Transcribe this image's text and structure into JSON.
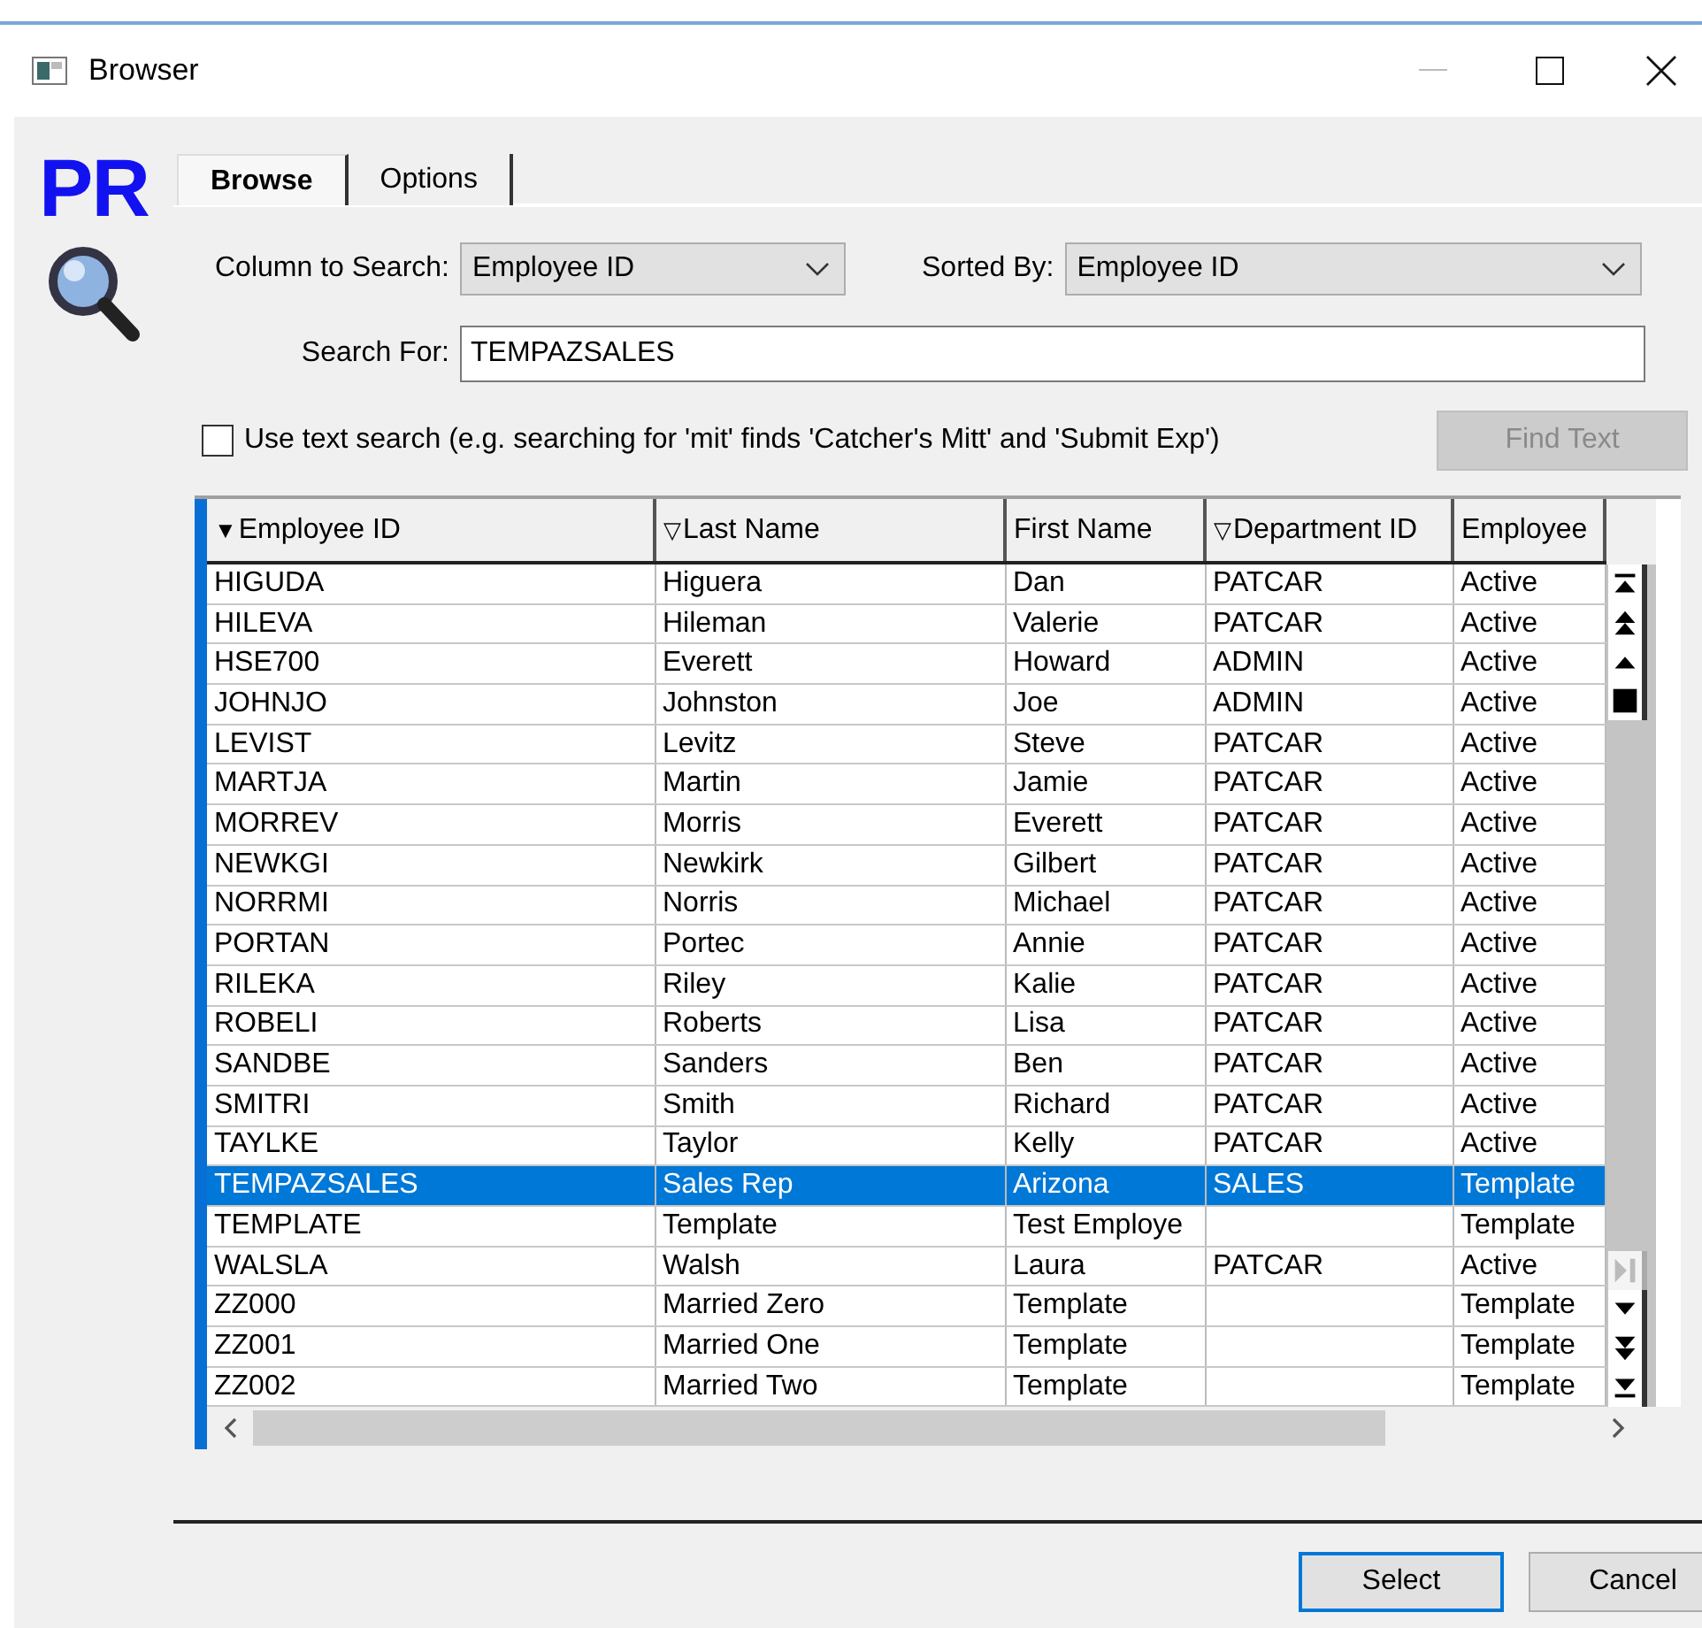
{
  "window": {
    "title": "Browser"
  },
  "logo": {
    "text": "PR"
  },
  "tabs": [
    {
      "label": "Browse",
      "selected": true
    },
    {
      "label": "Options",
      "selected": false
    }
  ],
  "column_to_search": {
    "label": "Column to Search:",
    "value": "Employee ID"
  },
  "sorted_by": {
    "label": "Sorted By:",
    "value": "Employee ID"
  },
  "search_for": {
    "label": "Search For:",
    "value": "TEMPAZSALES"
  },
  "text_search": {
    "label": "Use text search (e.g. searching for 'mit' finds 'Catcher's Mitt' and 'Submit Exp')",
    "checked": false
  },
  "find_text_button": {
    "label": "Find Text",
    "disabled": true
  },
  "table": {
    "columns": [
      {
        "label": "Employee ID",
        "sort_icon": "▼"
      },
      {
        "label": "Last Name",
        "sort_icon": "▽"
      },
      {
        "label": "First Name"
      },
      {
        "label": "Department ID",
        "sort_icon": "▽"
      },
      {
        "label": "Employee"
      }
    ],
    "rows": [
      {
        "cells": [
          "HIGUDA",
          "Higuera",
          "Dan",
          "PATCAR",
          "Active"
        ],
        "selected": false
      },
      {
        "cells": [
          "HILEVA",
          "Hileman",
          "Valerie",
          "PATCAR",
          "Active"
        ],
        "selected": false
      },
      {
        "cells": [
          "HSE700",
          "Everett",
          "Howard",
          "ADMIN",
          "Active"
        ],
        "selected": false
      },
      {
        "cells": [
          "JOHNJO",
          "Johnston",
          "Joe",
          "ADMIN",
          "Active"
        ],
        "selected": false
      },
      {
        "cells": [
          "LEVIST",
          "Levitz",
          "Steve",
          "PATCAR",
          "Active"
        ],
        "selected": false
      },
      {
        "cells": [
          "MARTJA",
          "Martin",
          "Jamie",
          "PATCAR",
          "Active"
        ],
        "selected": false
      },
      {
        "cells": [
          "MORREV",
          "Morris",
          "Everett",
          "PATCAR",
          "Active"
        ],
        "selected": false
      },
      {
        "cells": [
          "NEWKGI",
          "Newkirk",
          "Gilbert",
          "PATCAR",
          "Active"
        ],
        "selected": false
      },
      {
        "cells": [
          "NORRMI",
          "Norris",
          "Michael",
          "PATCAR",
          "Active"
        ],
        "selected": false
      },
      {
        "cells": [
          "PORTAN",
          "Portec",
          "Annie",
          "PATCAR",
          "Active"
        ],
        "selected": false
      },
      {
        "cells": [
          "RILEKA",
          "Riley",
          "Kalie",
          "PATCAR",
          "Active"
        ],
        "selected": false
      },
      {
        "cells": [
          "ROBELI",
          "Roberts",
          "Lisa",
          "PATCAR",
          "Active"
        ],
        "selected": false
      },
      {
        "cells": [
          "SANDBE",
          "Sanders",
          "Ben",
          "PATCAR",
          "Active"
        ],
        "selected": false
      },
      {
        "cells": [
          "SMITRI",
          "Smith",
          "Richard",
          "PATCAR",
          "Active"
        ],
        "selected": false
      },
      {
        "cells": [
          "TAYLKE",
          "Taylor",
          "Kelly",
          "PATCAR",
          "Active"
        ],
        "selected": false
      },
      {
        "cells": [
          "TEMPAZSALES",
          "Sales Rep",
          "Arizona",
          "SALES",
          "Template"
        ],
        "selected": true
      },
      {
        "cells": [
          "TEMPLATE",
          "Template",
          "Test Employe",
          "",
          "Template"
        ],
        "selected": false
      },
      {
        "cells": [
          "WALSLA",
          "Walsh",
          "Laura",
          "PATCAR",
          "Active"
        ],
        "selected": false
      },
      {
        "cells": [
          "ZZ000",
          "Married Zero",
          "Template",
          "",
          "Template"
        ],
        "selected": false
      },
      {
        "cells": [
          "ZZ001",
          "Married One",
          "Template",
          "",
          "Template"
        ],
        "selected": false
      },
      {
        "cells": [
          "ZZ002",
          "Married Two",
          "Template",
          "",
          "Template"
        ],
        "selected": false
      }
    ]
  },
  "buttons": [
    {
      "label": "Select",
      "default": true
    },
    {
      "label": "Cancel",
      "default": false
    }
  ]
}
